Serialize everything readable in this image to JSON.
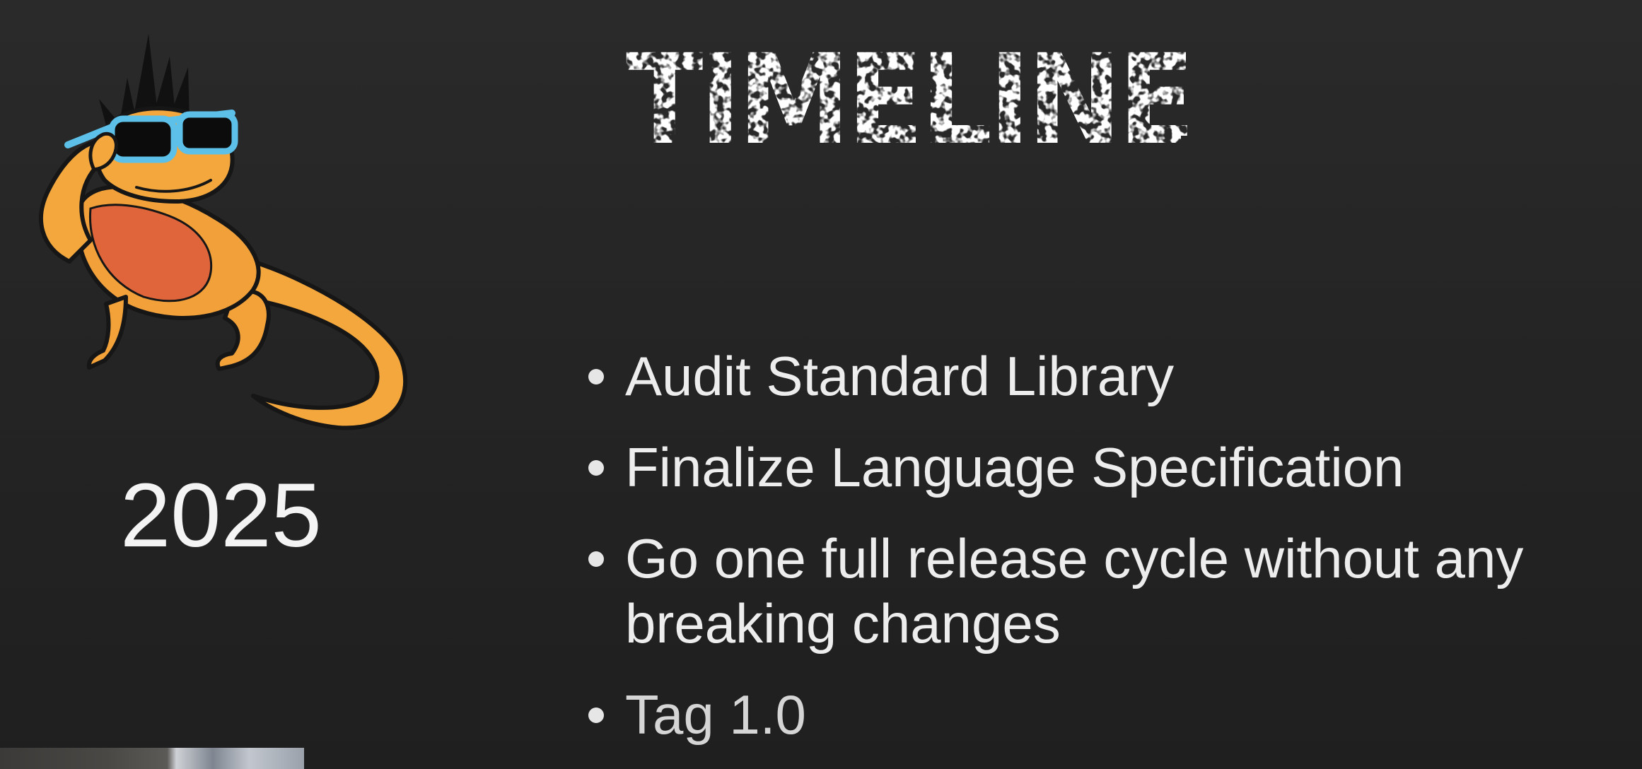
{
  "slide": {
    "title": "TIMELINE",
    "year": "2025",
    "bullets": [
      "Audit Standard Library",
      "Finalize Language Specification",
      "Go one full release cycle without any breaking changes",
      "Tag 1.0"
    ],
    "colors": {
      "background": "#252525",
      "text": "#ededed",
      "title": "#ffffff",
      "mascot_body": "#f4a73c",
      "mascot_belly": "#e0653a",
      "mascot_glasses_frame": "#5cc0e8"
    },
    "mascot": {
      "icon": "lizard-with-sunglasses-icon"
    }
  }
}
